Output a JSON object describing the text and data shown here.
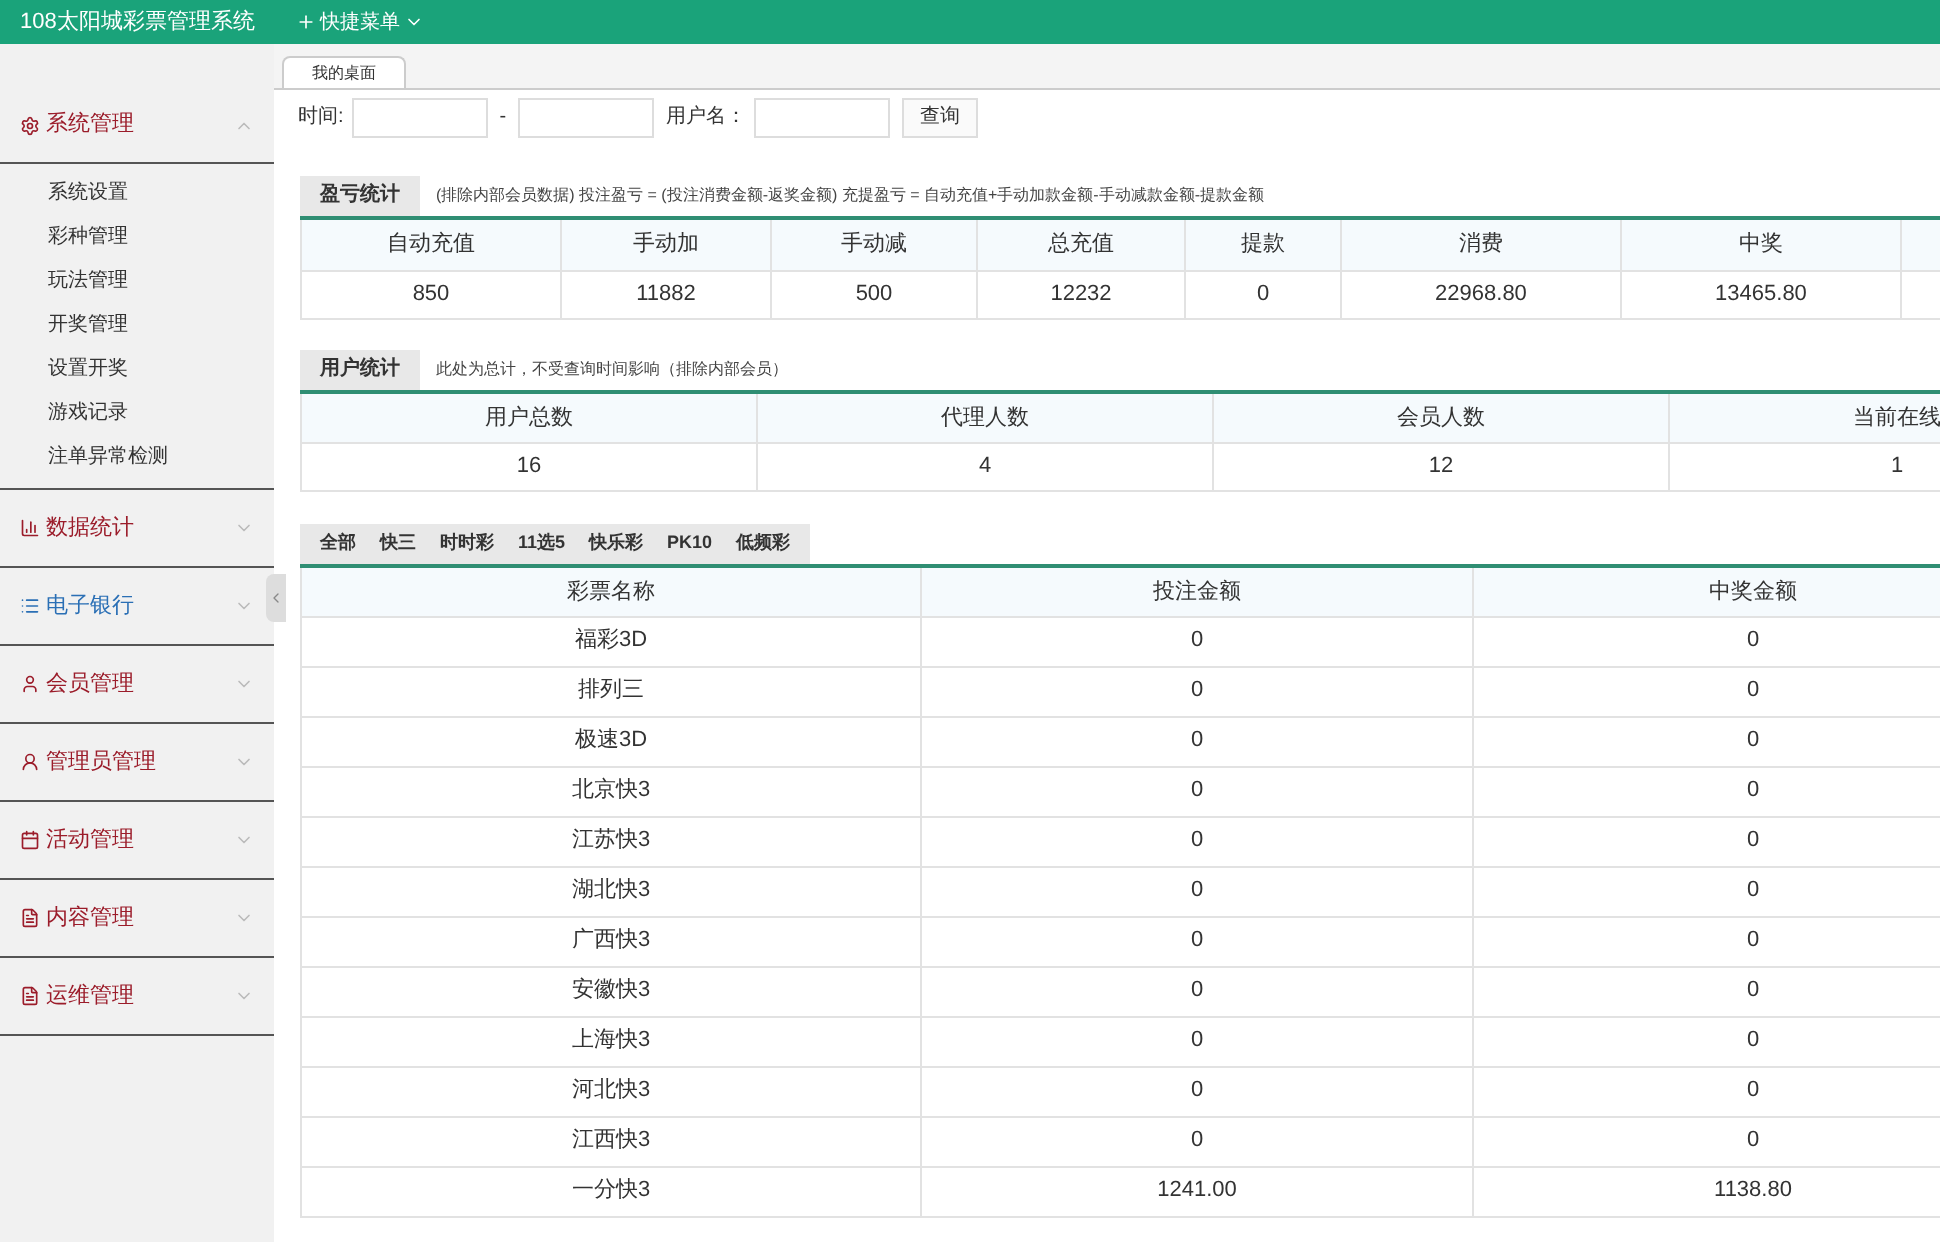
{
  "header": {
    "title": "108太阳城彩票管理系统",
    "quick_menu": "快捷菜单"
  },
  "sidebar": {
    "sections": [
      {
        "label": "系统管理",
        "expanded": true,
        "selected": false,
        "children": [
          {
            "label": "系统设置"
          },
          {
            "label": "彩种管理"
          },
          {
            "label": "玩法管理"
          },
          {
            "label": "开奖管理"
          },
          {
            "label": "设置开奖"
          },
          {
            "label": "游戏记录"
          },
          {
            "label": "注单异常检测"
          }
        ]
      },
      {
        "label": "数据统计",
        "expanded": false,
        "selected": false
      },
      {
        "label": "电子银行",
        "expanded": false,
        "selected": true
      },
      {
        "label": "会员管理",
        "expanded": false,
        "selected": false
      },
      {
        "label": "管理员管理",
        "expanded": false,
        "selected": false
      },
      {
        "label": "活动管理",
        "expanded": false,
        "selected": false
      },
      {
        "label": "内容管理",
        "expanded": false,
        "selected": false
      },
      {
        "label": "运维管理",
        "expanded": false,
        "selected": false
      }
    ]
  },
  "page_tab": "我的桌面",
  "search": {
    "time_label": "时间:",
    "separator": "-",
    "user_label": "用户名：",
    "button": "查询"
  },
  "profit": {
    "label": "盈亏统计",
    "note": "(排除内部会员数据)  投注盈亏 = (投注消费金额-返奖金额)    充提盈亏 = 自动充值+手动加款金额-手动减款金额-提款金额",
    "columns": [
      "自动充值",
      "手动加",
      "手动减",
      "总充值",
      "提款",
      "消费",
      "中奖"
    ],
    "row": [
      "850",
      "11882",
      "500",
      "12232",
      "0",
      "22968.80",
      "13465.80"
    ]
  },
  "users": {
    "label": "用户统计",
    "note": "此处为总计，不受查询时间影响（排除内部会员）",
    "columns": [
      "用户总数",
      "代理人数",
      "会员人数",
      "当前在线"
    ],
    "row": [
      "16",
      "4",
      "12",
      "1"
    ]
  },
  "lottery": {
    "tabs": [
      "全部",
      "快三",
      "时时彩",
      "11选5",
      "快乐彩",
      "PK10",
      "低频彩"
    ],
    "columns": [
      "彩票名称",
      "投注金额",
      "中奖金额"
    ],
    "rows": [
      [
        "福彩3D",
        "0",
        "0"
      ],
      [
        "排列三",
        "0",
        "0"
      ],
      [
        "极速3D",
        "0",
        "0"
      ],
      [
        "北京快3",
        "0",
        "0"
      ],
      [
        "江苏快3",
        "0",
        "0"
      ],
      [
        "湖北快3",
        "0",
        "0"
      ],
      [
        "广西快3",
        "0",
        "0"
      ],
      [
        "安徽快3",
        "0",
        "0"
      ],
      [
        "上海快3",
        "0",
        "0"
      ],
      [
        "河北快3",
        "0",
        "0"
      ],
      [
        "江西快3",
        "0",
        "0"
      ],
      [
        "一分快3",
        "1241.00",
        "1138.80"
      ]
    ]
  }
}
